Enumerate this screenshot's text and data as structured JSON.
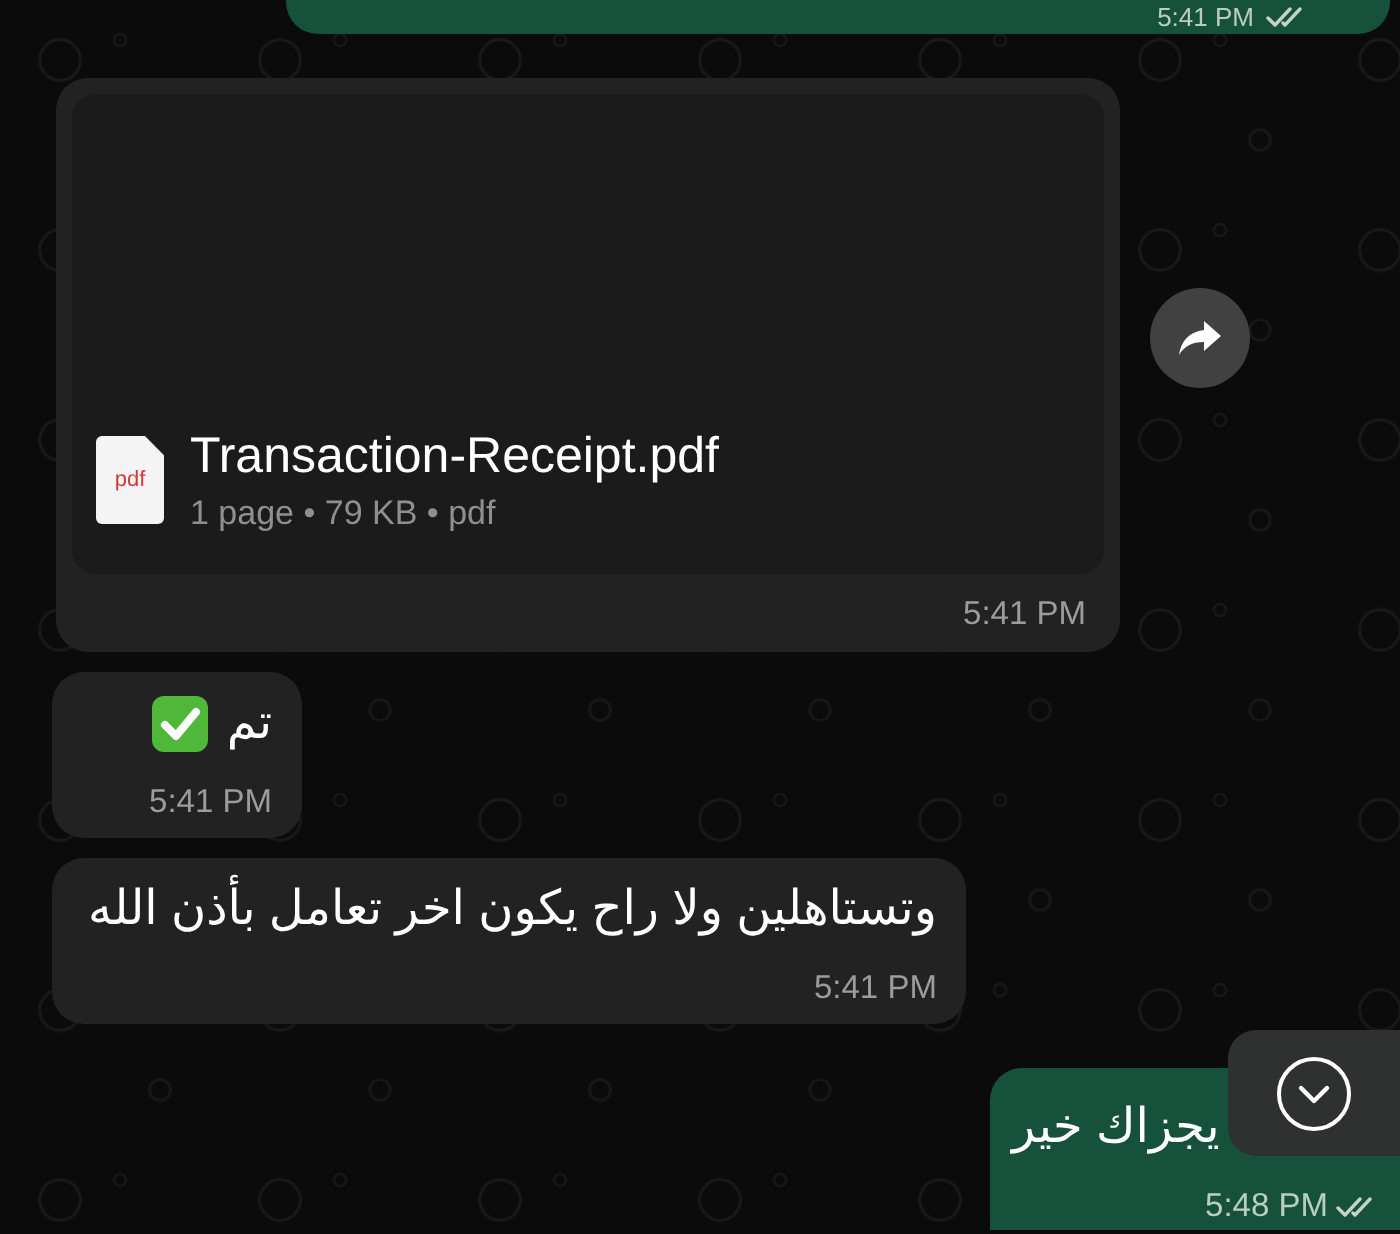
{
  "messages": [
    {
      "kind": "cut_off",
      "outgoing": true,
      "time": "5:41 PM",
      "delivered": true
    },
    {
      "kind": "document",
      "outgoing": false,
      "file_icon_label": "pdf",
      "file_name": "Transaction-Receipt.pdf",
      "meta": "1 page • 79 KB • pdf",
      "time": "5:41 PM"
    },
    {
      "kind": "text",
      "outgoing": false,
      "text": "تم",
      "check_emoji": true,
      "time": "5:41 PM"
    },
    {
      "kind": "text",
      "outgoing": false,
      "text": "وتستاهلين ولا راح يكون اخر تعامل بأذن الله",
      "check_emoji": false,
      "time": "5:41 PM"
    },
    {
      "kind": "text",
      "outgoing": true,
      "text": "يجزاك خير",
      "check_emoji": false,
      "time": "5:48 PM",
      "delivered": true
    }
  ]
}
